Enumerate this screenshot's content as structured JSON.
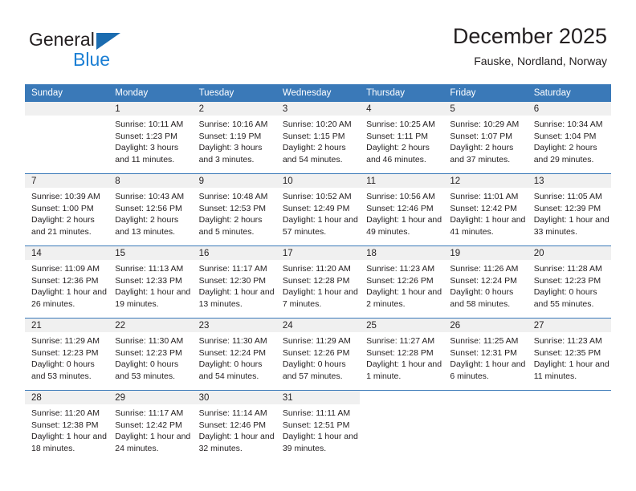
{
  "brand": {
    "name_top": "General",
    "name_bottom": "Blue",
    "triangle_color": "#1b6cb0",
    "blue_color": "#1b7fd4"
  },
  "header": {
    "title": "December 2025",
    "subtitle": "Fauske, Nordland, Norway"
  },
  "theme": {
    "header_blue": "#3a79b8",
    "band_gray": "#f0f0f0",
    "text": "#231f20"
  },
  "weekdays": [
    "Sunday",
    "Monday",
    "Tuesday",
    "Wednesday",
    "Thursday",
    "Friday",
    "Saturday"
  ],
  "weeks": [
    [
      {
        "day": "",
        "lines": []
      },
      {
        "day": "1",
        "lines": [
          "Sunrise: 10:11 AM",
          "Sunset: 1:23 PM",
          "Daylight: 3 hours",
          "and 11 minutes."
        ]
      },
      {
        "day": "2",
        "lines": [
          "Sunrise: 10:16 AM",
          "Sunset: 1:19 PM",
          "Daylight: 3 hours",
          "and 3 minutes."
        ]
      },
      {
        "day": "3",
        "lines": [
          "Sunrise: 10:20 AM",
          "Sunset: 1:15 PM",
          "Daylight: 2 hours",
          "and 54 minutes."
        ]
      },
      {
        "day": "4",
        "lines": [
          "Sunrise: 10:25 AM",
          "Sunset: 1:11 PM",
          "Daylight: 2 hours",
          "and 46 minutes."
        ]
      },
      {
        "day": "5",
        "lines": [
          "Sunrise: 10:29 AM",
          "Sunset: 1:07 PM",
          "Daylight: 2 hours",
          "and 37 minutes."
        ]
      },
      {
        "day": "6",
        "lines": [
          "Sunrise: 10:34 AM",
          "Sunset: 1:04 PM",
          "Daylight: 2 hours",
          "and 29 minutes."
        ]
      }
    ],
    [
      {
        "day": "7",
        "lines": [
          "Sunrise: 10:39 AM",
          "Sunset: 1:00 PM",
          "Daylight: 2 hours",
          "and 21 minutes."
        ]
      },
      {
        "day": "8",
        "lines": [
          "Sunrise: 10:43 AM",
          "Sunset: 12:56 PM",
          "Daylight: 2 hours",
          "and 13 minutes."
        ]
      },
      {
        "day": "9",
        "lines": [
          "Sunrise: 10:48 AM",
          "Sunset: 12:53 PM",
          "Daylight: 2 hours",
          "and 5 minutes."
        ]
      },
      {
        "day": "10",
        "lines": [
          "Sunrise: 10:52 AM",
          "Sunset: 12:49 PM",
          "Daylight: 1 hour and",
          "57 minutes."
        ]
      },
      {
        "day": "11",
        "lines": [
          "Sunrise: 10:56 AM",
          "Sunset: 12:46 PM",
          "Daylight: 1 hour and",
          "49 minutes."
        ]
      },
      {
        "day": "12",
        "lines": [
          "Sunrise: 11:01 AM",
          "Sunset: 12:42 PM",
          "Daylight: 1 hour and",
          "41 minutes."
        ]
      },
      {
        "day": "13",
        "lines": [
          "Sunrise: 11:05 AM",
          "Sunset: 12:39 PM",
          "Daylight: 1 hour and",
          "33 minutes."
        ]
      }
    ],
    [
      {
        "day": "14",
        "lines": [
          "Sunrise: 11:09 AM",
          "Sunset: 12:36 PM",
          "Daylight: 1 hour and",
          "26 minutes."
        ]
      },
      {
        "day": "15",
        "lines": [
          "Sunrise: 11:13 AM",
          "Sunset: 12:33 PM",
          "Daylight: 1 hour and",
          "19 minutes."
        ]
      },
      {
        "day": "16",
        "lines": [
          "Sunrise: 11:17 AM",
          "Sunset: 12:30 PM",
          "Daylight: 1 hour and",
          "13 minutes."
        ]
      },
      {
        "day": "17",
        "lines": [
          "Sunrise: 11:20 AM",
          "Sunset: 12:28 PM",
          "Daylight: 1 hour and",
          "7 minutes."
        ]
      },
      {
        "day": "18",
        "lines": [
          "Sunrise: 11:23 AM",
          "Sunset: 12:26 PM",
          "Daylight: 1 hour and",
          "2 minutes."
        ]
      },
      {
        "day": "19",
        "lines": [
          "Sunrise: 11:26 AM",
          "Sunset: 12:24 PM",
          "Daylight: 0 hours",
          "and 58 minutes."
        ]
      },
      {
        "day": "20",
        "lines": [
          "Sunrise: 11:28 AM",
          "Sunset: 12:23 PM",
          "Daylight: 0 hours",
          "and 55 minutes."
        ]
      }
    ],
    [
      {
        "day": "21",
        "lines": [
          "Sunrise: 11:29 AM",
          "Sunset: 12:23 PM",
          "Daylight: 0 hours",
          "and 53 minutes."
        ]
      },
      {
        "day": "22",
        "lines": [
          "Sunrise: 11:30 AM",
          "Sunset: 12:23 PM",
          "Daylight: 0 hours",
          "and 53 minutes."
        ]
      },
      {
        "day": "23",
        "lines": [
          "Sunrise: 11:30 AM",
          "Sunset: 12:24 PM",
          "Daylight: 0 hours",
          "and 54 minutes."
        ]
      },
      {
        "day": "24",
        "lines": [
          "Sunrise: 11:29 AM",
          "Sunset: 12:26 PM",
          "Daylight: 0 hours",
          "and 57 minutes."
        ]
      },
      {
        "day": "25",
        "lines": [
          "Sunrise: 11:27 AM",
          "Sunset: 12:28 PM",
          "Daylight: 1 hour and",
          "1 minute."
        ]
      },
      {
        "day": "26",
        "lines": [
          "Sunrise: 11:25 AM",
          "Sunset: 12:31 PM",
          "Daylight: 1 hour and",
          "6 minutes."
        ]
      },
      {
        "day": "27",
        "lines": [
          "Sunrise: 11:23 AM",
          "Sunset: 12:35 PM",
          "Daylight: 1 hour and",
          "11 minutes."
        ]
      }
    ],
    [
      {
        "day": "28",
        "lines": [
          "Sunrise: 11:20 AM",
          "Sunset: 12:38 PM",
          "Daylight: 1 hour and",
          "18 minutes."
        ]
      },
      {
        "day": "29",
        "lines": [
          "Sunrise: 11:17 AM",
          "Sunset: 12:42 PM",
          "Daylight: 1 hour and",
          "24 minutes."
        ]
      },
      {
        "day": "30",
        "lines": [
          "Sunrise: 11:14 AM",
          "Sunset: 12:46 PM",
          "Daylight: 1 hour and",
          "32 minutes."
        ]
      },
      {
        "day": "31",
        "lines": [
          "Sunrise: 11:11 AM",
          "Sunset: 12:51 PM",
          "Daylight: 1 hour and",
          "39 minutes."
        ]
      },
      {
        "day": "",
        "lines": [],
        "blank": true
      },
      {
        "day": "",
        "lines": [],
        "blank": true
      },
      {
        "day": "",
        "lines": [],
        "blank": true
      }
    ]
  ]
}
